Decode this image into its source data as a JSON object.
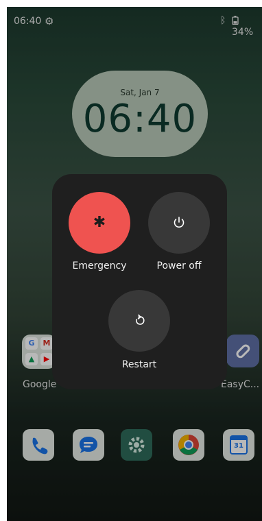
{
  "status_bar": {
    "time": "06:40",
    "battery_percent": "34%",
    "icons": [
      "settings-icon",
      "bluetooth-icon",
      "battery-icon"
    ]
  },
  "lock_clock": {
    "date": "Sat, Jan 7",
    "time": "06:40"
  },
  "home": {
    "google_folder_label": "Google",
    "easy_app_label": "EasyC...",
    "dock_icons": [
      "phone-icon",
      "messages-icon",
      "settings-icon",
      "chrome-icon",
      "calendar-icon"
    ],
    "calendar_day": "31"
  },
  "power_menu": {
    "emergency_label": "Emergency",
    "power_off_label": "Power off",
    "restart_label": "Restart",
    "emergency_color": "#ef5350",
    "button_color": "#383838",
    "panel_color": "#1f1f1f"
  }
}
